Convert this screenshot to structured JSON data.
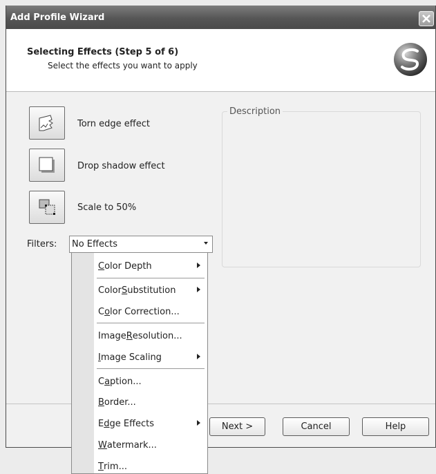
{
  "window": {
    "title": "Add Profile Wizard"
  },
  "header": {
    "title": "Selecting Effects (Step 5 of 6)",
    "subtitle": "Select the effects you want to apply"
  },
  "effects": [
    {
      "label": "Torn edge effect",
      "icon": "torn-edge-icon"
    },
    {
      "label": "Drop shadow effect",
      "icon": "drop-shadow-icon"
    },
    {
      "label": "Scale to 50%",
      "icon": "scale-icon"
    }
  ],
  "description": {
    "legend": "Description"
  },
  "filters": {
    "label": "Filters:",
    "selected": "No Effects"
  },
  "menu": {
    "items": [
      {
        "pre": "",
        "key": "C",
        "post": "olor Depth",
        "submenu": true
      },
      {
        "pre": "Color ",
        "key": "S",
        "post": "ubstitution",
        "submenu": true
      },
      {
        "pre": "C",
        "key": "o",
        "post": "lor Correction...",
        "submenu": false
      },
      {
        "pre": "Image ",
        "key": "R",
        "post": "esolution...",
        "submenu": false
      },
      {
        "pre": "",
        "key": "I",
        "post": "mage Scaling",
        "submenu": true
      },
      {
        "pre": "C",
        "key": "a",
        "post": "ption...",
        "submenu": false
      },
      {
        "pre": "",
        "key": "B",
        "post": "order...",
        "submenu": false
      },
      {
        "pre": "E",
        "key": "d",
        "post": "ge Effects",
        "submenu": true
      },
      {
        "pre": "",
        "key": "W",
        "post": "atermark...",
        "submenu": false
      },
      {
        "pre": "",
        "key": "T",
        "post": "rim...",
        "submenu": false
      }
    ]
  },
  "buttons": {
    "next": "Next >",
    "cancel": "Cancel",
    "help": "Help"
  }
}
